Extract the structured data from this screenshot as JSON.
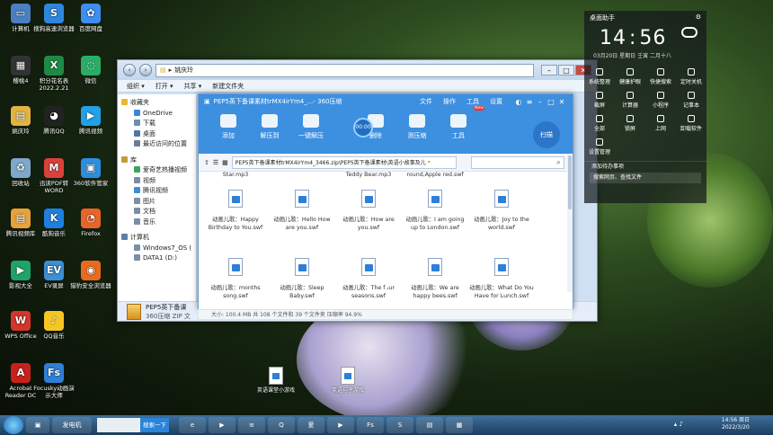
{
  "desktop": {
    "icons": [
      {
        "label": "计算机",
        "icon": "computer-icon",
        "color": "#4a7fc1",
        "glyph": "▭"
      },
      {
        "label": "搜狗高速浏览器",
        "icon": "sogou-browser-icon",
        "color": "#2e86de",
        "glyph": "S"
      },
      {
        "label": "百度网盘",
        "icon": "baidu-netdisk-icon",
        "color": "#3d8ef0",
        "glyph": "✿"
      },
      {
        "label": "樱桃4",
        "icon": "app-icon",
        "color": "#333333",
        "glyph": "▦"
      },
      {
        "label": "积分花名表2022.2.21",
        "icon": "excel-file-icon",
        "color": "#1f8a46",
        "glyph": "X"
      },
      {
        "label": "微信",
        "icon": "wechat-icon",
        "color": "#2aae67",
        "glyph": "◌"
      },
      {
        "label": "姚庆玲",
        "icon": "folder-icon",
        "color": "#e3b341",
        "glyph": "▤"
      },
      {
        "label": "腾讯QQ",
        "icon": "qq-icon",
        "color": "#222222",
        "glyph": "◕"
      },
      {
        "label": "腾讯视频",
        "icon": "tencent-video-icon",
        "color": "#22a1e8",
        "glyph": "▶"
      },
      {
        "label": "回收站",
        "icon": "recycle-bin-icon",
        "color": "#7fa7c9",
        "glyph": "♻"
      },
      {
        "label": "迅读PDF转WORD",
        "icon": "pdf-converter-icon",
        "color": "#d9423a",
        "glyph": "M"
      },
      {
        "label": "360软件管家",
        "icon": "360-manager-icon",
        "color": "#2d8ee0",
        "glyph": "▣"
      },
      {
        "label": "腾讯视频库",
        "icon": "video-library-icon",
        "color": "#e8a23a",
        "glyph": "▤"
      },
      {
        "label": "酷狗音乐",
        "icon": "kugou-icon",
        "color": "#1f7fe0",
        "glyph": "K"
      },
      {
        "label": "Firefox",
        "icon": "firefox-icon",
        "color": "#e8652a",
        "glyph": "◔"
      },
      {
        "label": "影视大全",
        "icon": "video-app-icon",
        "color": "#1fa36a",
        "glyph": "▶"
      },
      {
        "label": "EV录屏",
        "icon": "ev-recorder-icon",
        "color": "#3a8fd6",
        "glyph": "EV"
      },
      {
        "label": "猎豹安全浏览器",
        "icon": "cheetah-browser-icon",
        "color": "#e86a1f",
        "glyph": "◉"
      },
      {
        "label": "WPS Office",
        "icon": "wps-icon",
        "color": "#d5352b",
        "glyph": "W"
      },
      {
        "label": "QQ音乐",
        "icon": "qq-music-icon",
        "color": "#f5c623",
        "glyph": "♪"
      },
      {
        "label": "Acrobat Reader DC",
        "icon": "acrobat-icon",
        "color": "#c8211c",
        "glyph": "A"
      },
      {
        "label": "Focusky动画演示大师",
        "icon": "focusky-icon",
        "color": "#2f7fd6",
        "glyph": "Fs"
      }
    ],
    "files": [
      {
        "label": "英语课堂小游戏",
        "icon": "swf-file-icon"
      },
      {
        "label": "英语句子游戏",
        "icon": "swf-file-icon"
      }
    ]
  },
  "explorer": {
    "address_root": "▸",
    "address": "姚庆玲",
    "toolbar": [
      "组织 ▾",
      "打开 ▾",
      "共享 ▾",
      "新建文件夹"
    ],
    "sidebar": [
      {
        "label": "收藏夹",
        "type": "group",
        "icon": "star-icon",
        "color": "#e8b830"
      },
      {
        "label": "OneDrive",
        "type": "item",
        "icon": "cloud-icon",
        "color": "#3a86d8"
      },
      {
        "label": "下载",
        "type": "item",
        "icon": "download-icon",
        "color": "#6e8db5"
      },
      {
        "label": "桌面",
        "type": "item",
        "icon": "desktop-icon",
        "color": "#4f77a8"
      },
      {
        "label": "最近访问的位置",
        "type": "item",
        "icon": "recent-icon",
        "color": "#6b7d92"
      },
      {
        "label": "",
        "type": "spacer"
      },
      {
        "label": "库",
        "type": "group",
        "icon": "library-icon",
        "color": "#c69a3a"
      },
      {
        "label": "爱奇艺热播视频",
        "type": "item",
        "icon": "video-icon",
        "color": "#3aa65a"
      },
      {
        "label": "视频",
        "type": "item",
        "icon": "video-icon",
        "color": "#7a8ea7"
      },
      {
        "label": "腾讯视频",
        "type": "item",
        "icon": "video-icon",
        "color": "#3a8fd6"
      },
      {
        "label": "图片",
        "type": "item",
        "icon": "picture-icon",
        "color": "#7a8ea7"
      },
      {
        "label": "文档",
        "type": "item",
        "icon": "document-icon",
        "color": "#7a8ea7"
      },
      {
        "label": "音乐",
        "type": "item",
        "icon": "music-icon",
        "color": "#7a8ea7"
      },
      {
        "label": "",
        "type": "spacer"
      },
      {
        "label": "计算机",
        "type": "group",
        "icon": "computer-icon",
        "color": "#5a7fa8"
      },
      {
        "label": "Windows7_OS (",
        "type": "item",
        "icon": "drive-icon",
        "color": "#7a8ea7"
      },
      {
        "label": "DATA1 (D:)",
        "type": "item",
        "icon": "drive-icon",
        "color": "#7a8ea7"
      }
    ],
    "status_name": "PEP5英下备课",
    "status_type": "360压缩 ZIP 文"
  },
  "zip": {
    "title": "PEP5英下备课素材trMX4irYm4_...- 360压缩",
    "menus": [
      "文件",
      "操作",
      "工具",
      "设置"
    ],
    "tools": [
      {
        "label": "添加",
        "icon": "add-icon"
      },
      {
        "label": "解压到",
        "icon": "extract-icon"
      },
      {
        "label": "一键解压",
        "icon": "one-click-extract-icon"
      },
      {
        "label": "删除",
        "icon": "delete-icon"
      },
      {
        "label": "测压缩",
        "icon": "test-icon"
      },
      {
        "label": "工具",
        "icon": "tools-icon"
      }
    ],
    "speed": "00:00",
    "new_badge": "New",
    "logo": "扫描",
    "path": "PEP5英下备课素材trMX4irYm4_3466.zip\\PEP5英下备课素材\\英语小故事及儿",
    "partial_row": [
      "Star.mp3",
      "Teddy Bear.mp3",
      "round,Apple red.swf"
    ],
    "row1": [
      "动画儿歌：Happy Birthday to You.swf",
      "动画儿歌：Hello How are you.swf",
      "动画儿歌：How are you.swf",
      "动画儿歌：I am going up to London.swf",
      "动画儿歌：Joy to the world.swf"
    ],
    "row2": [
      "动画儿歌：months song.swf",
      "动画儿歌：Sleep Baby.swf",
      "动画儿歌：The four seasons.swf",
      "动画儿歌：We are happy bees.swf",
      "动画儿歌：What Do You Have for Lunch.swf"
    ]
  },
  "statusbar": "大小: 100.4 MB 共 108 个文件和 39 个文件夹 压缩率 94.9%",
  "widget": {
    "title": "桌面助手",
    "hour": "14",
    "minute": "56",
    "date": "03月20日 星期日  壬寅 二月十八",
    "items": [
      "系统整理",
      "健康护眼",
      "快捷搜索",
      "定时关机",
      "截屏",
      "计算器",
      "小程序",
      "记事本",
      "全部",
      "锁屏",
      "上网",
      "卸载软件",
      "设置管理"
    ],
    "todo": "添加待办事项",
    "search": "搜索网页、查找文件"
  },
  "taskbar": {
    "apps": [
      "▣",
      "发电机"
    ],
    "search_placeholder": "",
    "search_button": "搜索一下",
    "pinned": [
      "e",
      "▶",
      "≡",
      "Q",
      "爱",
      "▶",
      "Fs",
      "S",
      "▤",
      "▦"
    ],
    "time": "14:56 周日",
    "date": "2022/3/20"
  }
}
